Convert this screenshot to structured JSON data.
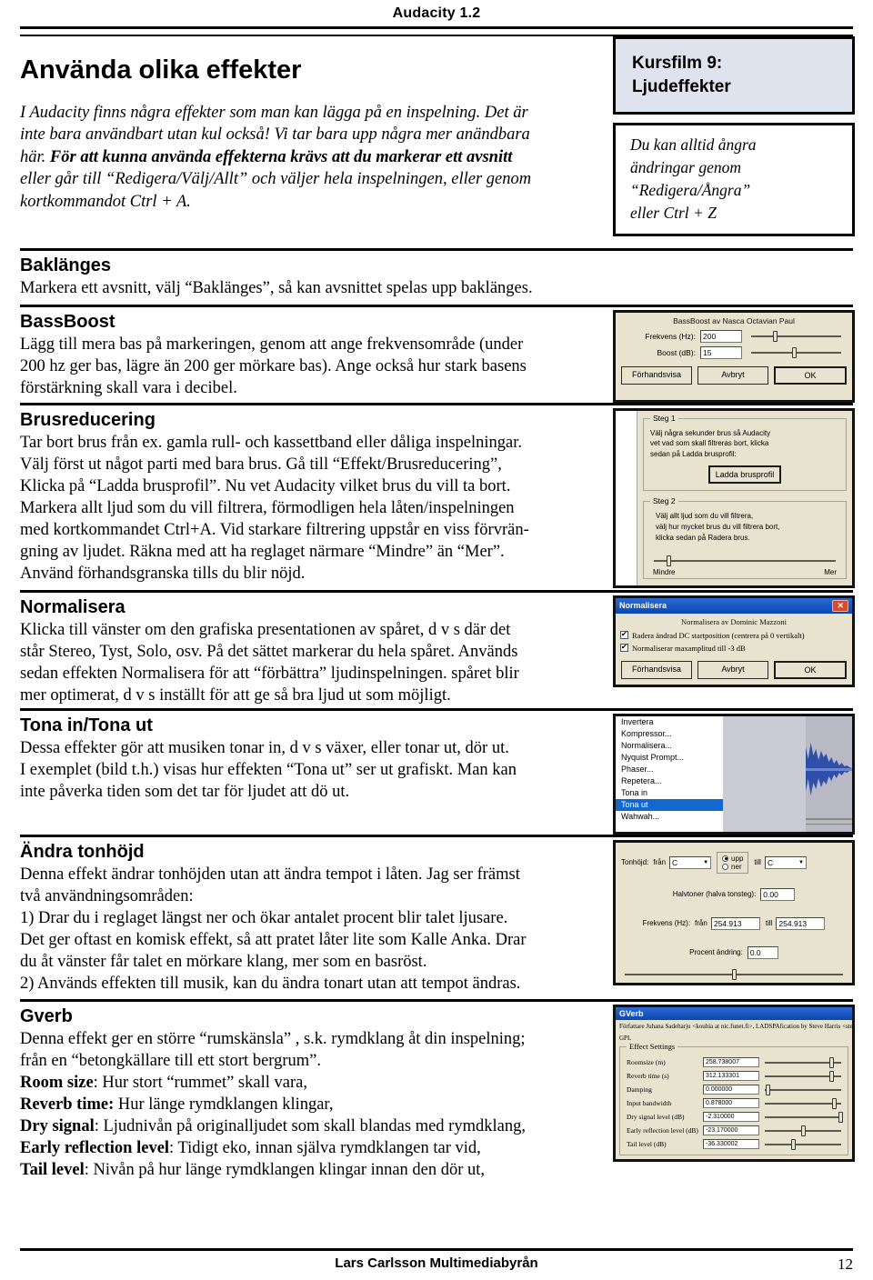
{
  "header": {
    "title": "Audacity 1.2"
  },
  "intro": {
    "heading": "Använda olika effekter",
    "line1": "I Audacity finns några effekter som man kan lägga på en inspelning. Det är",
    "line2": "inte bara användbart utan kul också! Vi tar bara upp några mer anändbara",
    "line3_plain": "här. ",
    "line3_bold": "För att kunna använda effekterna krävs att du markerar ett avsnitt",
    "line4": "eller går till “Redigera/Välj/Allt” och väljer hela inspelningen, eller genom",
    "line5": "kortkommandot Ctrl + A."
  },
  "callouts": {
    "film_line1": "Kursfilm 9:",
    "film_line2": "Ljudeffekter",
    "tip_line1": "Du kan alltid ångra",
    "tip_line2": "ändringar genom",
    "tip_line3": "“Redigera/Ångra”",
    "tip_line4": "eller Ctrl + Z"
  },
  "sections": {
    "baklanges": {
      "heading": "Baklänges",
      "body": "Markera ett avsnitt, välj “Baklänges”, så kan avsnittet spelas upp baklänges."
    },
    "bassboost": {
      "heading": "BassBoost",
      "line1": "Lägg till mera bas på markeringen, genom att ange frekvensområde (under",
      "line2": "200 hz ger bas, lägre än 200 ger mörkare bas). Ange också hur stark basens",
      "line3": "förstärkning skall vara i decibel."
    },
    "brusreducering": {
      "heading": "Brusreducering",
      "line1": "Tar bort brus från ex. gamla rull- och kassettband eller dåliga inspelningar.",
      "line2": "Välj först ut något parti med bara brus. Gå till “Effekt/Brusreducering”,",
      "line3": "Klicka på “Ladda brusprofil”. Nu vet Audacity vilket brus du vill ta bort.",
      "line4": "Markera allt ljud som du vill filtrera, förmodligen hela låten/inspelningen",
      "line5": "med kortkommandet Ctrl+A. Vid starkare filtrering uppstår en viss förvrän-",
      "line6": "gning av ljudet. Räkna med att ha reglaget närmare “Mindre” än “Mer”.",
      "line7": "Använd förhandsgranska tills du blir nöjd."
    },
    "normalisera": {
      "heading": "Normalisera",
      "line1": "Klicka till vänster om den grafiska presentationen av spåret, d v s där det",
      "line2": "står Stereo, Tyst, Solo, osv. På det sättet markerar du hela spåret. Används",
      "line3": "sedan effekten Normalisera för att “förbättra” ljudinspelningen. spåret blir",
      "line4": "mer optimerat, d v s inställt för att ge så bra ljud ut som möjligt."
    },
    "tona": {
      "heading": "Tona in/Tona ut",
      "line1": "Dessa effekter gör att musiken tonar in, d v s växer, eller tonar ut, dör ut.",
      "line2": "I exemplet (bild t.h.) visas hur effekten “Tona ut” ser ut grafiskt. Man kan",
      "line3": "inte påverka tiden som det tar för ljudet att dö ut."
    },
    "tonhojd": {
      "heading": "Ändra tonhöjd",
      "line1": "Denna effekt ändrar tonhöjden utan att ändra tempot i låten. Jag ser främst",
      "line2": "två användningsområden:",
      "line3": "1) Drar du i reglaget längst ner och ökar antalet procent blir talet ljusare.",
      "line4": "Det ger oftast en komisk effekt, så att pratet låter lite som Kalle Anka. Drar",
      "line5": "du åt vänster får talet en mörkare klang, mer som en basröst.",
      "line6": "2)  Används effekten till musik, kan du ändra tonart utan att tempot ändras."
    },
    "gverb": {
      "heading": "Gverb",
      "line1": "Denna effekt ger en större “rumskänsla” , s.k. rymdklang åt din inspelning;",
      "line2": "från en “betongkällare till ett stort bergrum”.",
      "p1_bold": "Room size",
      "p1_rest": ": Hur stort “rummet” skall vara,",
      "p2_bold": "Reverb time:",
      "p2_rest": " Hur länge rymdklangen klingar,",
      "p3_bold": "Dry signal",
      "p3_rest": ": Ljudnivån på originalljudet som skall blandas med rymdklang,",
      "p4_bold": "Early reflection level",
      "p4_rest": ": Tidigt eko, innan själva rymdklangen tar vid,",
      "p5_bold": "Tail level",
      "p5_rest": ": Nivån på hur länge rymdklangen klingar innan den dör ut,"
    }
  },
  "dialogs": {
    "bassboost": {
      "caption": "BassBoost av Nasca Octavian Paul",
      "freq_label": "Frekvens (Hz):",
      "freq_value": "200",
      "boost_label": "Boost (dB):",
      "boost_value": "15",
      "btn_preview": "Förhandsvisa",
      "btn_cancel": "Avbryt",
      "btn_ok": "OK"
    },
    "noise": {
      "step1_title": "Steg 1",
      "step1_l1": "Välj några sekunder brus så Audacity",
      "step1_l2": "vet vad som skall filtreras bort, klicka",
      "step1_l3": "sedan på Ladda brusprofil:",
      "step1_btn": "Ladda brusprofil",
      "step2_title": "Steg 2",
      "step2_l1": "Välj allt ljud som du vill filtrera,",
      "step2_l2": "välj hur mycket brus du vill filtrera bort,",
      "step2_l3": "klicka sedan på Radera brus.",
      "slider_min": "Mindre",
      "slider_max": "Mer"
    },
    "normalisera": {
      "title": "Normalisera",
      "close": "✕",
      "caption": "Normalisera av Dominic Mazzoni",
      "chk1": "Radera ändrad DC startposition (centrera på 0 vertikalt)",
      "chk2": "Normaliserar maxamplitud till -3 dB",
      "btn_preview": "Förhandsvisa",
      "btn_cancel": "Avbryt",
      "btn_ok": "OK"
    },
    "effect_menu": {
      "items": [
        "Invertera",
        "Kompressor...",
        "Normalisera...",
        "Nyquist Prompt...",
        "Phaser...",
        "Repetera...",
        "Tona in",
        "Tona ut",
        "Wahwah..."
      ],
      "selected": "Tona ut"
    },
    "pitch": {
      "pitch_label": "Tonhöjd:",
      "from_label": "från",
      "from_note": "C",
      "radio_up": "upp",
      "radio_down": "ner",
      "to_label": "till",
      "to_note": "C",
      "semitone_label": "Halvtoner (halva tonsteg):",
      "semitone_value": "0.00",
      "freq_label": "Frekvens (Hz):",
      "freq_from_label": "från",
      "freq_from": "254.913",
      "freq_to_label": "till",
      "freq_to": "254.913",
      "percent_label": "Procent ändring:",
      "percent_value": "0.0"
    },
    "gverb": {
      "title": "GVerb",
      "author_line1": "Författare Juhana Sadeharju <kouhia at nic.funet.fi>, LADSPAfication by Steve Harris <steve",
      "author_line2": "GPL",
      "group_title": "Effect Settings",
      "rows": [
        {
          "label": "Roomsize (m)",
          "value": "258.738007",
          "thumb": 84
        },
        {
          "label": "Reverb time (s)",
          "value": "312.133301",
          "thumb": 84
        },
        {
          "label": "Damping",
          "value": "0.000000",
          "thumb": 1
        },
        {
          "label": "Input bandwidth",
          "value": "0.878000",
          "thumb": 88
        },
        {
          "label": "Dry signal level (dB)",
          "value": "-2.310000",
          "thumb": 97
        },
        {
          "label": "Early reflection level (dB)",
          "value": "-23.170000",
          "thumb": 48
        },
        {
          "label": "Tail level (dB)",
          "value": "-36.330002",
          "thumb": 35
        }
      ]
    }
  },
  "footer": {
    "text": "Lars Carlsson Multimediabyrån",
    "page": "12"
  }
}
